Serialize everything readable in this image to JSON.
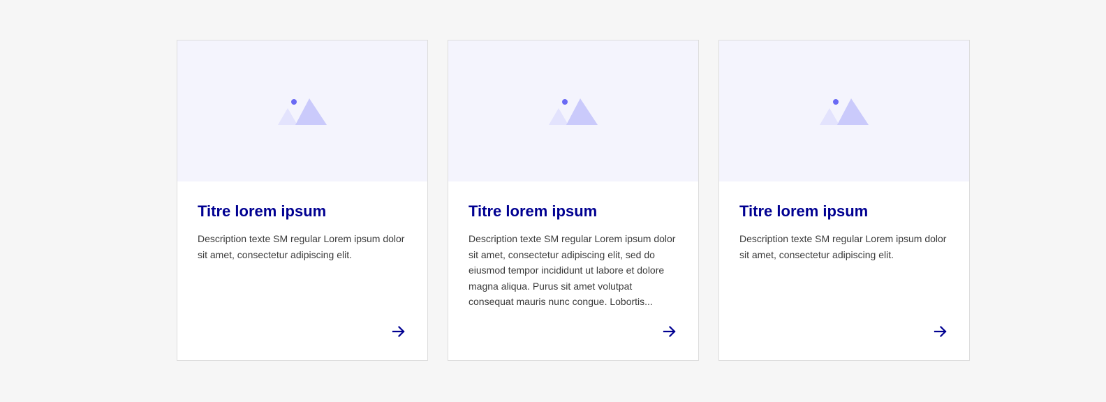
{
  "colors": {
    "background": "#f6f6f6",
    "card_background": "#ffffff",
    "card_border": "#dddddd",
    "media_background": "#f4f4fd",
    "title": "#000091",
    "description": "#3a3a3a",
    "arrow": "#000091"
  },
  "cards": [
    {
      "image_icon": "image-placeholder-icon",
      "title": "Titre lorem ipsum",
      "description": "Description texte SM regular Lorem ipsum dolor sit amet, consectetur adipiscing elit.",
      "link_icon": "arrow-right-icon"
    },
    {
      "image_icon": "image-placeholder-icon",
      "title": "Titre lorem ipsum",
      "description": "Description texte SM regular Lorem ipsum dolor sit amet, consectetur adipiscing elit, sed do eiusmod tempor incididunt ut labore et dolore magna aliqua. Purus sit amet volutpat consequat mauris nunc congue. Lobortis...",
      "link_icon": "arrow-right-icon"
    },
    {
      "image_icon": "image-placeholder-icon",
      "title": "Titre lorem ipsum",
      "description": "Description texte SM regular Lorem ipsum dolor sit amet, consectetur adipiscing elit.",
      "link_icon": "arrow-right-icon"
    }
  ]
}
